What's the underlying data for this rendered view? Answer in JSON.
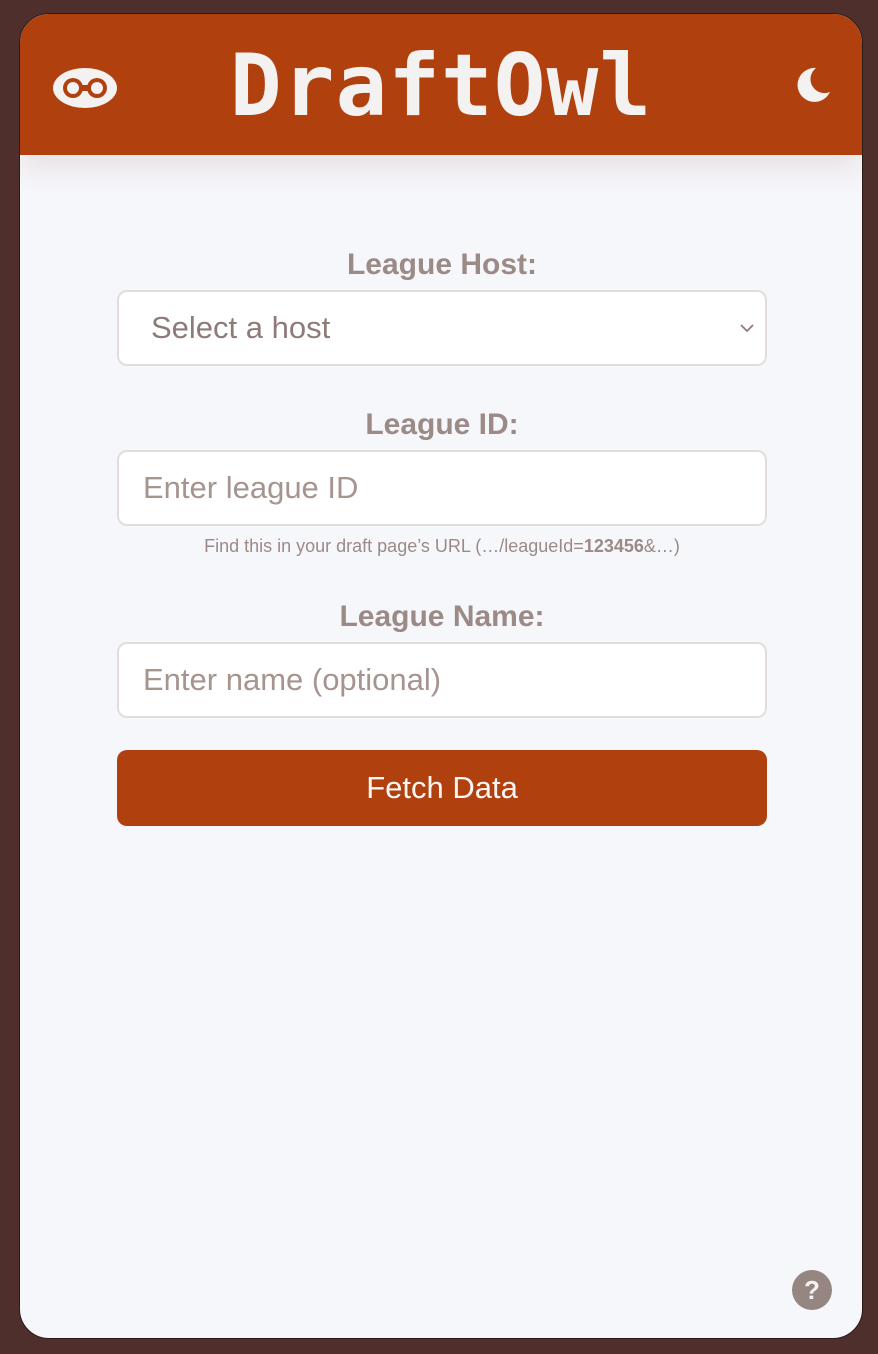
{
  "header": {
    "brand_title": "DraftOwl",
    "logo_icon": "owl-eyes-icon",
    "theme_toggle_icon": "moon-icon"
  },
  "form": {
    "host": {
      "label": "League Host:",
      "selected_value": "Select a host",
      "icon": "chevron-down-icon"
    },
    "league_id": {
      "label": "League ID:",
      "placeholder": "Enter league ID",
      "hint_prefix": "Find this in your draft page’s URL (…/leagueId=",
      "hint_bold": "123456",
      "hint_suffix": "&…)"
    },
    "league_name": {
      "label": "League Name:",
      "placeholder": "Enter name (optional)"
    },
    "submit_label": "Fetch Data"
  },
  "help": {
    "label": "?",
    "icon": "help-icon"
  },
  "colors": {
    "brand": "#b1400f",
    "page_bg": "#f6f7fb",
    "outer_bg": "#4e2f2c",
    "label_text": "#9b8a86"
  }
}
